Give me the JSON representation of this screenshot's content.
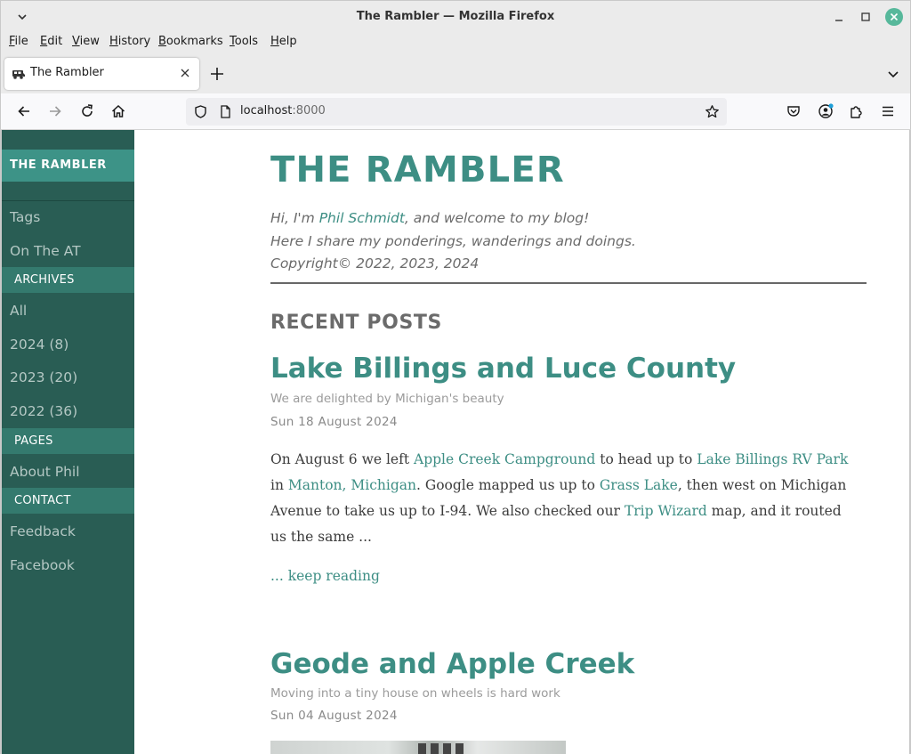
{
  "window": {
    "title": "The Rambler — Mozilla Firefox"
  },
  "menu": [
    "File",
    "Edit",
    "View",
    "History",
    "Bookmarks",
    "Tools",
    "Help"
  ],
  "tab": {
    "title": "The Rambler"
  },
  "urlbar": {
    "host": "localhost",
    "port": ":8000"
  },
  "sidebar": {
    "brand": "THE RAMBLER",
    "links_top": [
      "Tags",
      "On The AT"
    ],
    "archives_head": "ARCHIVES",
    "archives": [
      "All",
      "2024 (8)",
      "2023 (20)",
      "2022 (36)"
    ],
    "pages_head": "PAGES",
    "pages": [
      "About Phil"
    ],
    "contact_head": "CONTACT",
    "contact": [
      "Feedback",
      "Facebook"
    ]
  },
  "header": {
    "title": "THE RAMBLER",
    "intro_pre": "Hi, I'm ",
    "intro_name": "Phil Schmidt",
    "intro_post": ", and welcome to my blog!",
    "intro_line2": "Here I share my ponderings, wanderings and doings.",
    "copyright": "Copyright© 2022, 2023, 2024"
  },
  "recent_heading": "RECENT POSTS",
  "posts": [
    {
      "title": "Lake Billings and Luce County",
      "subtitle": "We are delighted by Michigan's beauty",
      "date": "Sun 18 August 2024",
      "l1_a": "On August 6 we left ",
      "l1_link1": "Apple Creek Campground",
      "l1_b": " to head up to ",
      "l1_link2": "Lake Billings RV Park",
      "l2_a": "in ",
      "l2_link1": "Manton, Michigan",
      "l2_b": ". Google mapped us up to ",
      "l2_link2": "Grass Lake",
      "l2_c": ", then west on Michigan",
      "l3": "Avenue to take us up to I-94. We also checked our ",
      "l3_link": "Trip Wizard",
      "l3_b": " map, and it routed",
      "l4": "us the same ...",
      "keep_reading": "... keep reading"
    },
    {
      "title": "Geode and Apple Creek",
      "subtitle": "Moving into a tiny house on wheels is hard work",
      "date": "Sun 04 August 2024"
    }
  ]
}
